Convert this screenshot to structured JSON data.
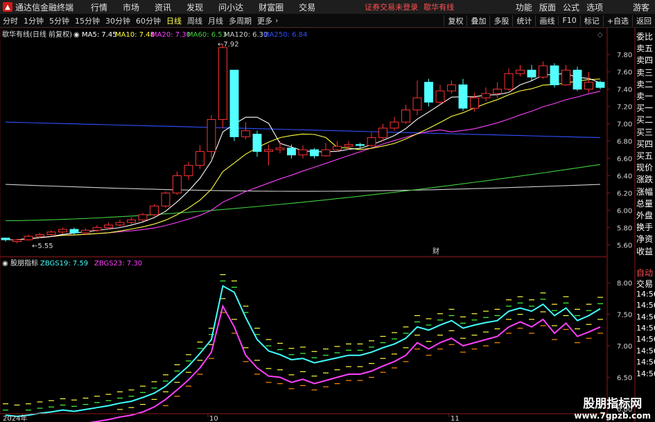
{
  "app": {
    "title": "通达信金融终端",
    "login_notice": "证券交易未登录",
    "stock_link": "歇华有线",
    "user": "游客"
  },
  "menu": [
    "行情",
    "市场",
    "资讯",
    "发现",
    "问小达",
    "财富圈",
    "交易"
  ],
  "menu_right": [
    "功能",
    "版面",
    "公式",
    "选项"
  ],
  "periods": [
    "分时",
    "1分钟",
    "5分钟",
    "15分钟",
    "30分钟",
    "60分钟",
    "日线",
    "周线",
    "月线",
    "多周期",
    "更多"
  ],
  "active_period": "日线",
  "toolbar_right": [
    "复权",
    "叠加",
    "多股",
    "统计",
    "画线",
    "F10",
    "标记",
    "+自选",
    "返回"
  ],
  "main_legend": {
    "title": "歇华有线(日线 前复权)",
    "items": [
      {
        "label": "MA5: 7.45",
        "color": "#ffffff"
      },
      {
        "label": "MA10: 7.48",
        "color": "#ffff40"
      },
      {
        "label": "MA20: 7.30",
        "color": "#ff40ff"
      },
      {
        "label": "MA60: 6.53",
        "color": "#40d040"
      },
      {
        "label": "MA120: 6.30",
        "color": "#d0d0d0"
      },
      {
        "label": "MA250: 6.84",
        "color": "#3050ff"
      }
    ]
  },
  "price_axis": [
    "7.80",
    "7.60",
    "7.40",
    "7.20",
    "7.00",
    "6.80",
    "6.60",
    "6.40",
    "6.20",
    "6.00",
    "5.80",
    "5.60"
  ],
  "price_annotations": {
    "high": "7.92",
    "low": "5.55",
    "finance_marker": "财"
  },
  "indicator_legend": {
    "title": "股朋指标",
    "items": [
      {
        "label": "ZBGS19: 7.59",
        "color": "#40ffff"
      },
      {
        "label": "ZBGS23: 7.30",
        "color": "#ff40ff"
      }
    ]
  },
  "indicator_axis": [
    "8.00",
    "7.50",
    "7.00",
    "6.50",
    "6.00"
  ],
  "date_axis": [
    "2024年",
    "10",
    "11"
  ],
  "right_panel": [
    "委比",
    "卖五",
    "卖四",
    "卖三",
    "卖二",
    "卖一",
    "买一",
    "买二",
    "买三",
    "买四",
    "买五",
    "现价",
    "涨跌",
    "涨幅",
    "总量",
    "外盘",
    "换手",
    "净资",
    "收益"
  ],
  "right_panel_lower": [
    "自动",
    "交易",
    "14:56",
    "14:56",
    "14:56",
    "14:56",
    "14:56",
    "14:56",
    "14:56",
    "14:56"
  ],
  "watermark": {
    "line1": "股朋指标网",
    "line2": "www.7gpzb.com"
  },
  "chart_data": [
    {
      "type": "candlestick",
      "title": "歇华有线(日线 前复权)",
      "ylim": [
        5.5,
        7.95
      ],
      "ohlc": [
        [
          5.68,
          5.66,
          5.68,
          5.64
        ],
        [
          5.64,
          5.66,
          5.67,
          5.62
        ],
        [
          5.66,
          5.7,
          5.72,
          5.65
        ],
        [
          5.7,
          5.72,
          5.74,
          5.68
        ],
        [
          5.72,
          5.75,
          5.77,
          5.7
        ],
        [
          5.75,
          5.78,
          5.8,
          5.73
        ],
        [
          5.78,
          5.74,
          5.8,
          5.72
        ],
        [
          5.74,
          5.77,
          5.79,
          5.72
        ],
        [
          5.77,
          5.8,
          5.83,
          5.75
        ],
        [
          5.8,
          5.83,
          5.86,
          5.78
        ],
        [
          5.83,
          5.86,
          5.89,
          5.81
        ],
        [
          5.86,
          5.89,
          5.92,
          5.84
        ],
        [
          5.89,
          5.95,
          5.97,
          5.87
        ],
        [
          5.95,
          6.05,
          6.07,
          5.93
        ],
        [
          6.05,
          6.2,
          6.22,
          6.03
        ],
        [
          6.2,
          6.4,
          6.45,
          6.18
        ],
        [
          6.4,
          6.52,
          6.56,
          6.35
        ],
        [
          6.52,
          6.68,
          6.75,
          6.48
        ],
        [
          6.68,
          7.05,
          7.1,
          6.6
        ],
        [
          7.05,
          7.88,
          7.92,
          6.95
        ],
        [
          7.62,
          6.85,
          7.18,
          6.8
        ],
        [
          6.85,
          6.92,
          7.02,
          6.82
        ],
        [
          6.88,
          6.68,
          6.92,
          6.62
        ],
        [
          6.68,
          6.7,
          6.76,
          6.52
        ],
        [
          6.7,
          6.72,
          6.8,
          6.66
        ],
        [
          6.72,
          6.64,
          6.76,
          6.6
        ],
        [
          6.64,
          6.7,
          6.75,
          6.6
        ],
        [
          6.7,
          6.63,
          6.72,
          6.6
        ],
        [
          6.63,
          6.7,
          6.78,
          6.62
        ],
        [
          6.7,
          6.74,
          6.8,
          6.68
        ],
        [
          6.74,
          6.76,
          6.8,
          6.7
        ],
        [
          6.76,
          6.75,
          6.78,
          6.72
        ],
        [
          6.75,
          6.84,
          6.9,
          6.73
        ],
        [
          6.84,
          6.95,
          7.0,
          6.8
        ],
        [
          6.95,
          7.02,
          7.08,
          6.92
        ],
        [
          7.02,
          7.16,
          7.22,
          7.0
        ],
        [
          7.16,
          7.3,
          7.5,
          7.1
        ],
        [
          7.48,
          7.25,
          7.52,
          7.2
        ],
        [
          7.25,
          7.38,
          7.45,
          7.22
        ],
        [
          7.38,
          7.45,
          7.5,
          7.35
        ],
        [
          7.45,
          7.18,
          7.52,
          7.15
        ],
        [
          7.18,
          7.3,
          7.36,
          7.14
        ],
        [
          7.3,
          7.35,
          7.42,
          7.26
        ],
        [
          7.35,
          7.4,
          7.48,
          7.3
        ],
        [
          7.4,
          7.58,
          7.64,
          7.38
        ],
        [
          7.58,
          7.62,
          7.68,
          7.55
        ],
        [
          7.62,
          7.54,
          7.68,
          7.5
        ],
        [
          7.54,
          7.67,
          7.72,
          7.52
        ],
        [
          7.67,
          7.45,
          7.7,
          7.42
        ],
        [
          7.45,
          7.62,
          7.68,
          7.44
        ],
        [
          7.62,
          7.4,
          7.66,
          7.38
        ],
        [
          7.4,
          7.48,
          7.6,
          7.36
        ],
        [
          7.48,
          7.42,
          7.5,
          7.4
        ]
      ]
    },
    {
      "type": "line",
      "title": "股朋指标",
      "ylim": [
        6.0,
        8.2
      ],
      "series": [
        {
          "name": "ZBGS19",
          "values": [
            5.9,
            5.88,
            5.9,
            5.93,
            5.95,
            5.98,
            5.96,
            5.99,
            6.02,
            6.05,
            6.09,
            6.12,
            6.18,
            6.25,
            6.36,
            6.52,
            6.68,
            6.88,
            7.1,
            7.95,
            7.85,
            7.45,
            7.1,
            6.92,
            6.86,
            6.78,
            6.8,
            6.73,
            6.77,
            6.81,
            6.85,
            6.85,
            6.9,
            6.97,
            7.03,
            7.12,
            7.3,
            7.25,
            7.33,
            7.4,
            7.28,
            7.33,
            7.37,
            7.4,
            7.55,
            7.6,
            7.55,
            7.66,
            7.48,
            7.6,
            7.4,
            7.48,
            7.59
          ]
        },
        {
          "name": "ZBGS23",
          "values": [
            5.65,
            5.63,
            5.66,
            5.7,
            5.73,
            5.76,
            5.74,
            5.77,
            5.8,
            5.83,
            5.87,
            5.9,
            5.95,
            6.03,
            6.15,
            6.3,
            6.46,
            6.65,
            6.9,
            7.63,
            7.3,
            6.85,
            6.65,
            6.52,
            6.5,
            6.42,
            6.47,
            6.4,
            6.45,
            6.5,
            6.55,
            6.55,
            6.6,
            6.68,
            6.75,
            6.85,
            7.05,
            6.95,
            7.05,
            7.12,
            7.0,
            7.05,
            7.1,
            7.15,
            7.3,
            7.38,
            7.3,
            7.42,
            7.2,
            7.36,
            7.15,
            7.22,
            7.3
          ]
        }
      ]
    }
  ]
}
